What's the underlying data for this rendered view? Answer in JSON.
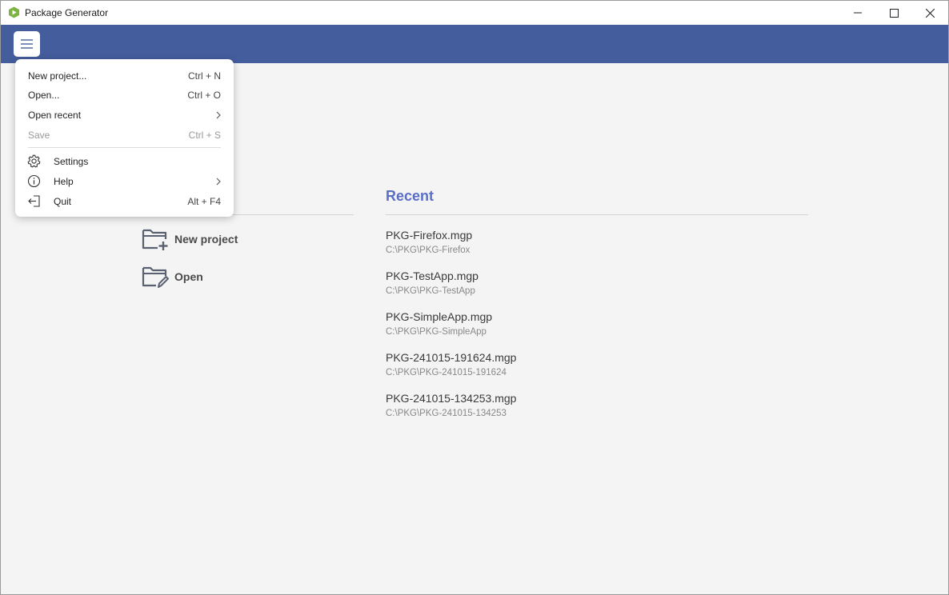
{
  "window": {
    "title": "Package Generator"
  },
  "menu": {
    "items": [
      {
        "label": "New project...",
        "shortcut": "Ctrl + N"
      },
      {
        "label": "Open...",
        "shortcut": "Ctrl + O"
      },
      {
        "label": "Open recent",
        "submenu": true
      },
      {
        "label": "Save",
        "shortcut": "Ctrl + S",
        "disabled": true
      },
      {
        "label": "Settings",
        "icon": "gear-icon"
      },
      {
        "label": "Help",
        "icon": "info-icon",
        "submenu": true
      },
      {
        "label": "Quit",
        "shortcut": "Alt + F4",
        "icon": "exit-icon"
      }
    ]
  },
  "start": {
    "new_project_label": "New project",
    "open_label": "Open"
  },
  "recent": {
    "heading": "Recent",
    "items": [
      {
        "name": "PKG-Firefox.mgp",
        "path": "C:\\PKG\\PKG-Firefox"
      },
      {
        "name": "PKG-TestApp.mgp",
        "path": "C:\\PKG\\PKG-TestApp"
      },
      {
        "name": "PKG-SimpleApp.mgp",
        "path": "C:\\PKG\\PKG-SimpleApp"
      },
      {
        "name": "PKG-241015-191624.mgp",
        "path": "C:\\PKG\\PKG-241015-191624"
      },
      {
        "name": "PKG-241015-134253.mgp",
        "path": "C:\\PKG\\PKG-241015-134253"
      }
    ]
  },
  "colors": {
    "appbar": "#445d9d",
    "accent_heading": "#5b6fc4",
    "logo_green": "#7cb342"
  }
}
